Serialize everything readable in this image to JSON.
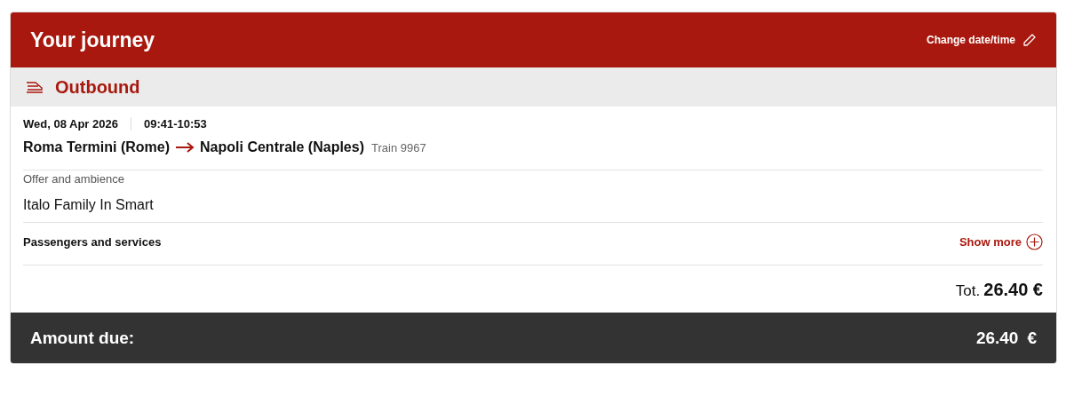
{
  "header": {
    "title": "Your journey",
    "action": "Change date/time"
  },
  "section": {
    "title": "Outbound"
  },
  "trip": {
    "date": "Wed, 08 Apr 2026",
    "time": "09:41-10:53",
    "from": "Roma Termini (Rome)",
    "to": "Napoli Centrale (Naples)",
    "train": "Train 9967"
  },
  "offer": {
    "label": "Offer and ambience",
    "value": "Italo Family In Smart"
  },
  "passengers": {
    "label": "Passengers and services",
    "action": "Show more"
  },
  "total": {
    "label": "Tot.",
    "amount": "26.40 €"
  },
  "footer": {
    "label": "Amount due:",
    "amount": "26.40",
    "currency": "€"
  }
}
